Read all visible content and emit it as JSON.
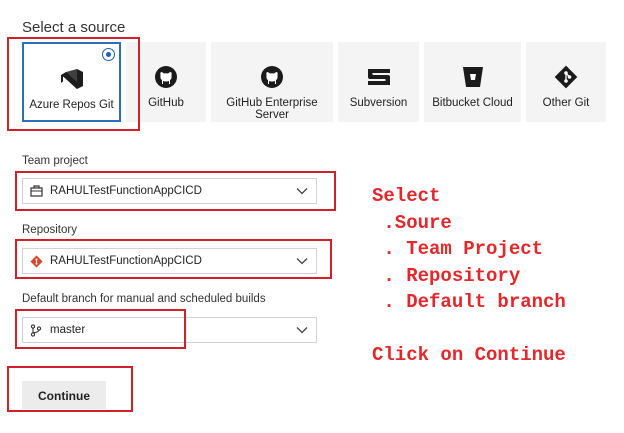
{
  "source_section": {
    "heading": "Select a source",
    "selected": "Azure Repos Git",
    "tiles": [
      {
        "label": "Azure Repos Git",
        "icon": "azure-repos-icon"
      },
      {
        "label": "GitHub",
        "icon": "github-icon"
      },
      {
        "label_line1": "GitHub Enterprise",
        "label_line2": "Server",
        "icon": "github-icon"
      },
      {
        "label": "Subversion",
        "icon": "subversion-icon"
      },
      {
        "label": "Bitbucket Cloud",
        "icon": "bitbucket-icon"
      },
      {
        "label": "Other Git",
        "icon": "git-icon"
      }
    ]
  },
  "team_project": {
    "label": "Team project",
    "value": "RAHULTestFunctionAppCICD",
    "icon": "project-icon"
  },
  "repository": {
    "label": "Repository",
    "value": "RAHULTestFunctionAppCICD",
    "icon": "git-repo-icon"
  },
  "default_branch": {
    "label": "Default branch for manual and scheduled builds",
    "value": "master",
    "icon": "branch-icon"
  },
  "continue_button": {
    "label": "Continue"
  },
  "annotation": {
    "lines": [
      "Select",
      " .Soure",
      " . Team Project",
      " . Repository",
      " . Default branch",
      "",
      "Click on Continue"
    ]
  },
  "colors": {
    "annotation": "#e3282c",
    "selected_border": "#2b6fb6",
    "highlight_box": "#d0202a"
  }
}
